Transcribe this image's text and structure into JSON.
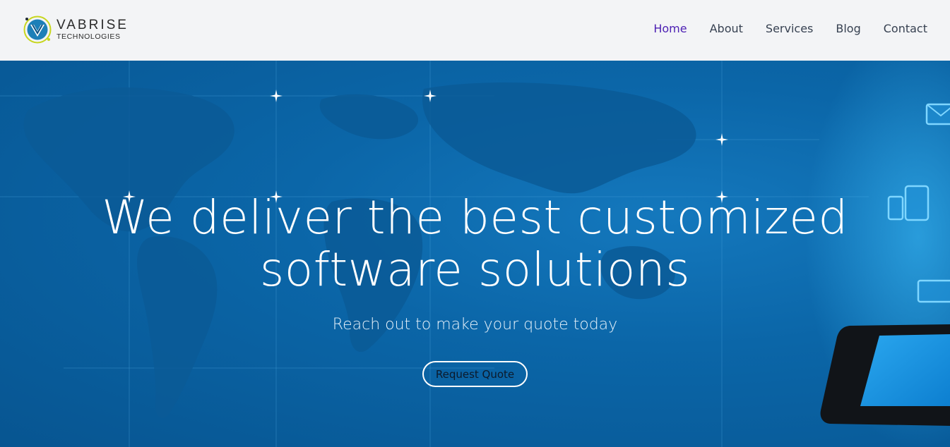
{
  "header": {
    "logo": {
      "name": "VABRISE",
      "tagline": "TECHNOLOGIES",
      "icon": "vabrise-logo-icon"
    },
    "nav": [
      {
        "label": "Home",
        "active": true
      },
      {
        "label": "About",
        "active": false
      },
      {
        "label": "Services",
        "active": false
      },
      {
        "label": "Blog",
        "active": false
      },
      {
        "label": "Contact",
        "active": false
      }
    ]
  },
  "hero": {
    "title_line1": "We deliver the best customized",
    "title_line2": "software solutions",
    "subtitle": "Reach out to make your quote today",
    "cta_label": "Request Quote",
    "background": "world-map-technology-image"
  },
  "colors": {
    "header_bg": "#f3f4f6",
    "nav_text": "#374151",
    "nav_active": "#4c1fb3",
    "hero_blue": "#0b66a8",
    "hero_text": "#ffffff"
  }
}
